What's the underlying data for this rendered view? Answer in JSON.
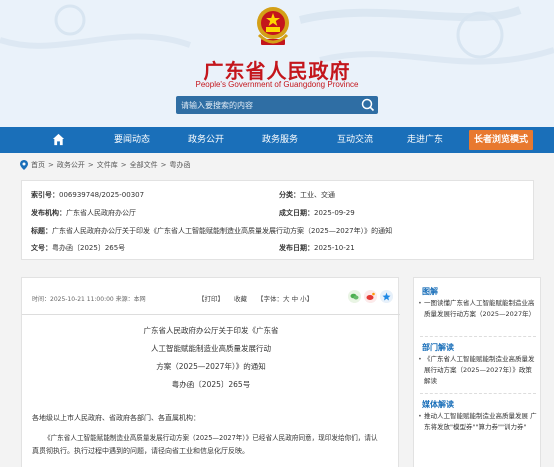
{
  "header": {
    "title": "广东省人民政府",
    "subtitle": "People's Government of Guangdong Province",
    "search_placeholder": "请输入要搜索的内容"
  },
  "nav": {
    "items": [
      "要闻动态",
      "政务公开",
      "政务服务",
      "互动交流",
      "走进广东"
    ],
    "elder_mode": "长者浏览模式"
  },
  "breadcrumb": [
    "首页",
    "政务公开",
    "文件库",
    "全部文件",
    "粤办函"
  ],
  "info": {
    "index_label": "索引号：",
    "index_value": "006939748/2025-00307",
    "category_label": "分类：",
    "category_value": "工业、交通",
    "issuer_label": "发布机构：",
    "issuer_value": "广东省人民政府办公厅",
    "date_label": "成文日期：",
    "date_value": "2025-09-29",
    "title_label": "标题：",
    "title_value": "广东省人民政府办公厅关于印发《广东省人工智能赋能制造业高质量发展行动方案（2025—2027年）》的通知",
    "docno_label": "文号：",
    "docno_value": "粤办函〔2025〕265号",
    "pubdate_label": "发布日期：",
    "pubdate_value": "2025-10-21"
  },
  "article": {
    "meta": "时间：2025-10-21 11:00:00    来源：本网",
    "tools": [
      "【打印】",
      "收藏",
      "【字体：大  中  小】"
    ],
    "title_lines": [
      "广东省人民政府办公厅关于印发《广东省",
      "人工智能赋能制造业高质量发展行动",
      "方案（2025—2027年）》的通知"
    ],
    "doc_no": "粤办函〔2025〕265号",
    "salutation": "各地级以上市人民政府、省政府各部门、各直属机构：",
    "para1": "《广东省人工智能赋能制造业高质量发展行动方案（2025—2027年）》已经省人民政府同意，现印发给你们，请认",
    "para2": "真贯彻执行。执行过程中遇到的问题，请径向省工业和信息化厅反映。"
  },
  "sidebar": {
    "sections": [
      {
        "title": "图解",
        "items": [
          "一图读懂广东省人工智能赋能制造业高质量发展行动方案（2025—2027年）"
        ]
      },
      {
        "title": "部门解读",
        "items": [
          "《广东省人工智能赋能制造业高质量发展行动方案（2025—2027年）》政策解读"
        ]
      },
      {
        "title": "媒体解读",
        "items": [
          "推动人工智能赋能制造业高质量发展 广东将发放\"模型券\"\"算力券\"\"训力券\""
        ]
      }
    ]
  },
  "colors": {
    "primary": "#1a6fb9",
    "brand_red": "#c4161c",
    "elder_orange": "#e8792f"
  }
}
